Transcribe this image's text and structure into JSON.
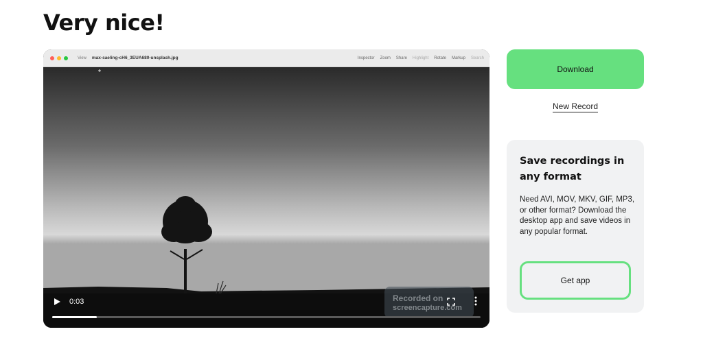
{
  "page": {
    "title": "Very nice!"
  },
  "player": {
    "window_bar": {
      "menu_view": "View",
      "file_name": "max-saeling-cH6_3EUA680-unsplash.jpg",
      "toolbar": [
        "Inspector",
        "Zoom",
        "Share",
        "Highlight",
        "Rotate",
        "Markup",
        "Search"
      ]
    },
    "watermark": {
      "line1": "Recorded on",
      "line2": "screencapture.com"
    },
    "current_time": "0:03",
    "progress_fraction": 0.104,
    "icons": {
      "play": "play-icon",
      "fullscreen": "fullscreen-icon",
      "more": "more-vertical-icon"
    }
  },
  "actions": {
    "download_label": "Download",
    "new_record_label": "New Record"
  },
  "promo": {
    "title": "Save recordings in any format",
    "description": "Need AVI, MOV, MKV, GIF, MP3, or other format? Download the desktop app and save videos in any popular format.",
    "button_label": "Get app"
  },
  "colors": {
    "accent_green": "#66e07f",
    "card_bg": "#f1f2f3",
    "player_bg": "#0d0d0d"
  }
}
